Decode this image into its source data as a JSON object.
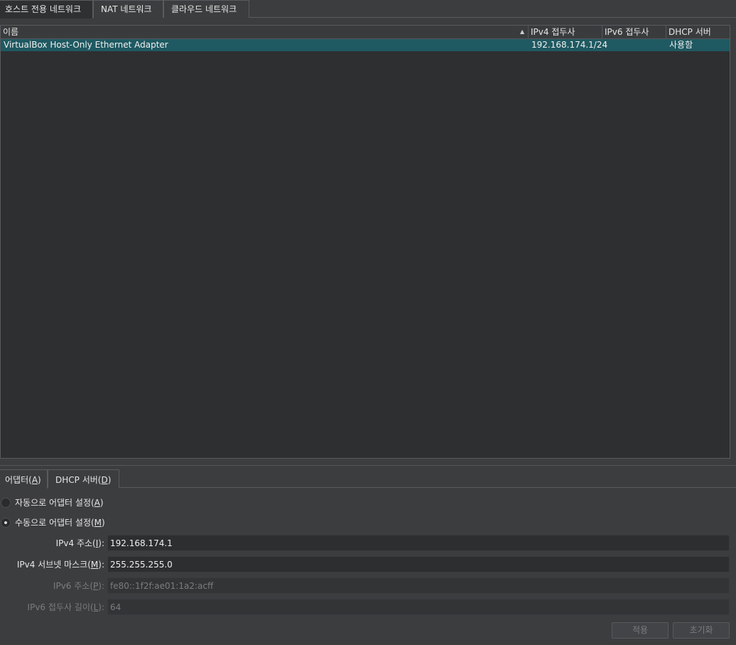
{
  "top_tabs": [
    "호스트 전용 네트워크",
    "NAT 네트워크",
    "클라우드 네트워크"
  ],
  "list": {
    "columns": [
      "이름",
      "IPv4 접두사",
      "IPv6 접두사",
      "DHCP 서버"
    ],
    "rows": [
      {
        "name": "VirtualBox Host-Only Ethernet Adapter",
        "ipv4": "192.168.174.1/24",
        "ipv6": "",
        "dhcp": "사용함"
      }
    ]
  },
  "bottom_tabs": {
    "adapter": {
      "text": "어댑터(",
      "mnemonic": "A",
      "suffix": ")"
    },
    "dhcp": {
      "text": "DHCP 서버(",
      "mnemonic": "D",
      "suffix": ")"
    }
  },
  "radios": {
    "auto": {
      "text": "자동으로 어댑터 설정(",
      "mnemonic": "A",
      "suffix": ")",
      "selected": false
    },
    "manual": {
      "text": "수동으로 어댑터 설정(",
      "mnemonic": "M",
      "suffix": ")",
      "selected": true
    }
  },
  "form": {
    "ipv4_address": {
      "label": "IPv4 주소(",
      "mnemonic": "I",
      "suffix": "):",
      "value": "192.168.174.1"
    },
    "ipv4_mask": {
      "label": "IPv4 서브넷 마스크(",
      "mnemonic": "M",
      "suffix": "):",
      "value": "255.255.255.0"
    },
    "ipv6_address": {
      "label": "IPv6 주소(",
      "mnemonic": "P",
      "suffix": "):",
      "value": "fe80::1f2f:ae01:1a2:acff"
    },
    "ipv6_prefix": {
      "label": "IPv6 접두사 길이(",
      "mnemonic": "L",
      "suffix": "):",
      "value": "64"
    }
  },
  "buttons": {
    "apply": "적용",
    "reset": "초기화"
  }
}
